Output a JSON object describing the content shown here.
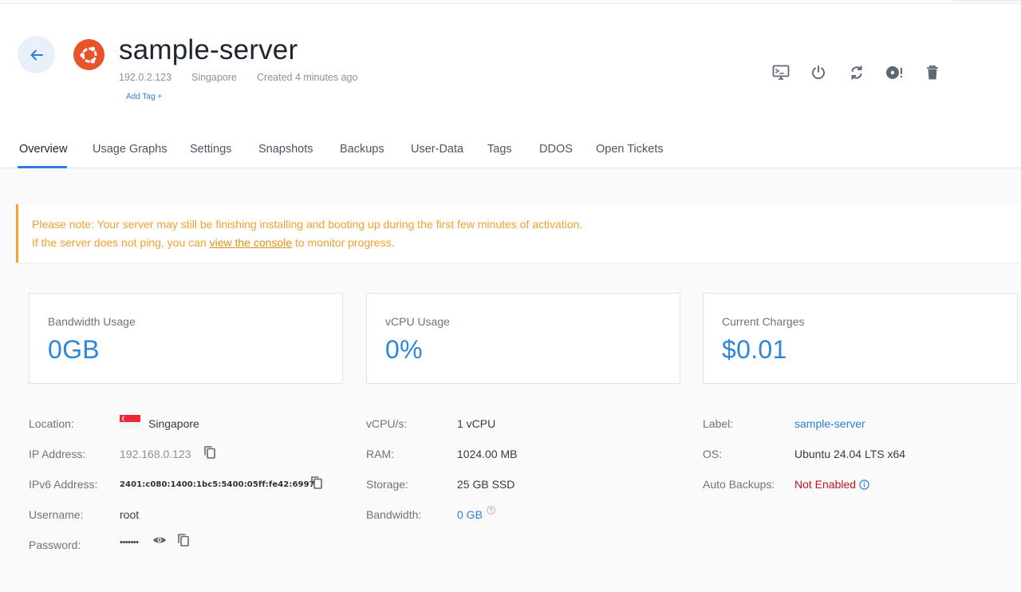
{
  "server": {
    "name": "sample-server",
    "ip": "192.0.2.123",
    "location": "Singapore",
    "created": "Created 4 minutes ago",
    "add_tag": "Add Tag +"
  },
  "actions": [
    {
      "name": "console-icon"
    },
    {
      "name": "power-icon"
    },
    {
      "name": "restart-icon"
    },
    {
      "name": "iso-disc-icon"
    },
    {
      "name": "trash-icon"
    }
  ],
  "tabs": [
    {
      "label": "Overview",
      "active": true
    },
    {
      "label": "Usage Graphs"
    },
    {
      "label": "Settings"
    },
    {
      "label": "Snapshots"
    },
    {
      "label": "Backups"
    },
    {
      "label": "User-Data"
    },
    {
      "label": "Tags"
    },
    {
      "label": "DDOS"
    },
    {
      "label": "Open Tickets"
    }
  ],
  "notice": {
    "line1": "Please note: Your server may still be finishing installing and booting up during the first few minutes of activation.",
    "line2_before": "If the server does not ping, you can ",
    "line2_link": "view the console",
    "line2_after": " to monitor progress."
  },
  "stats": [
    {
      "label": "Bandwidth Usage",
      "value": "0GB"
    },
    {
      "label": "vCPU Usage",
      "value": "0%"
    },
    {
      "label": "Current Charges",
      "value": "$0.01"
    }
  ],
  "details": {
    "col1": [
      {
        "label": "Location:",
        "value": "Singapore"
      },
      {
        "label": "IP Address:",
        "value": "192.168.0.123"
      },
      {
        "label": "IPv6 Address:",
        "value": "2401:c080:1400:1bc5:5400:05ff:fe42:6997"
      },
      {
        "label": "Username:",
        "value": "root"
      },
      {
        "label": "Password:",
        "value": "•••••••"
      }
    ],
    "col2": [
      {
        "label": "vCPU/s:",
        "value": "1 vCPU"
      },
      {
        "label": "RAM:",
        "value": "1024.00 MB"
      },
      {
        "label": "Storage:",
        "value": "25 GB SSD"
      },
      {
        "label": "Bandwidth:",
        "value": "0 GB"
      }
    ],
    "col3": [
      {
        "label": "Label:",
        "value": "sample-server"
      },
      {
        "label": "OS:",
        "value": "Ubuntu 24.04 LTS x64"
      },
      {
        "label": "Auto Backups:",
        "value": "Not Enabled"
      }
    ]
  },
  "colors": {
    "accent": "#2d7fd6",
    "warning": "#f5a02c",
    "danger": "#c0141b",
    "ubuntu": "#e8532a"
  }
}
